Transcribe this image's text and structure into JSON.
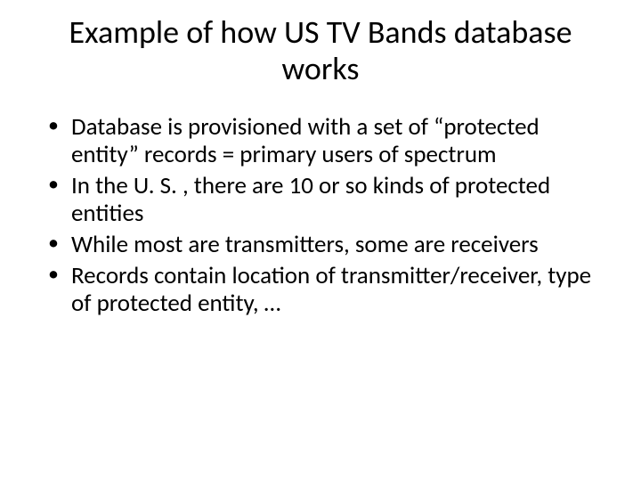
{
  "title": "Example of how US TV Bands database works",
  "bullets": [
    "Database is provisioned with a set of “protected entity” records = primary users of spectrum",
    "In the U. S. , there are 10 or so kinds of protected entities",
    "While most are transmitters, some are receivers",
    "Records contain location of transmitter/receiver, type of protected entity, …"
  ]
}
